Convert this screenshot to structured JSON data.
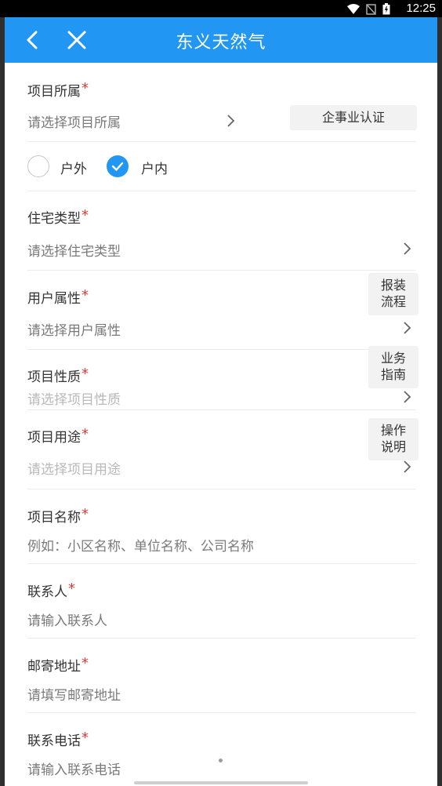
{
  "status": {
    "time": "12:25"
  },
  "appbar": {
    "title": "东义天然气"
  },
  "project_belong": {
    "label": "项目所属",
    "placeholder": "请选择项目所属",
    "cert_button": "企事业认证"
  },
  "location": {
    "options": [
      "户外",
      "户内"
    ],
    "selected": "户内"
  },
  "house_type": {
    "label": "住宅类型",
    "placeholder": "请选择住宅类型"
  },
  "user_attr": {
    "label": "用户属性",
    "placeholder": "请选择用户属性"
  },
  "project_nature": {
    "label": "项目性质",
    "placeholder": "请选择项目性质"
  },
  "project_use": {
    "label": "项目用途",
    "placeholder": "请选择项目用途"
  },
  "project_name": {
    "label": "项目名称",
    "placeholder": "例如：小区名称、单位名称、公司名称"
  },
  "contact": {
    "label": "联系人",
    "placeholder": "请输入联系人"
  },
  "mail_address": {
    "label": "邮寄地址",
    "placeholder": "请填写邮寄地址"
  },
  "phone": {
    "label": "联系电话",
    "placeholder": "请输入联系电话"
  },
  "side_buttons": [
    {
      "line1": "报装",
      "line2": "流程"
    },
    {
      "line1": "业务",
      "line2": "指南"
    },
    {
      "line1": "操作",
      "line2": "说明"
    }
  ],
  "required_mark": "*",
  "colors": {
    "appbar": "#2196f3",
    "required": "#e53935",
    "accent": "#2196f3"
  }
}
